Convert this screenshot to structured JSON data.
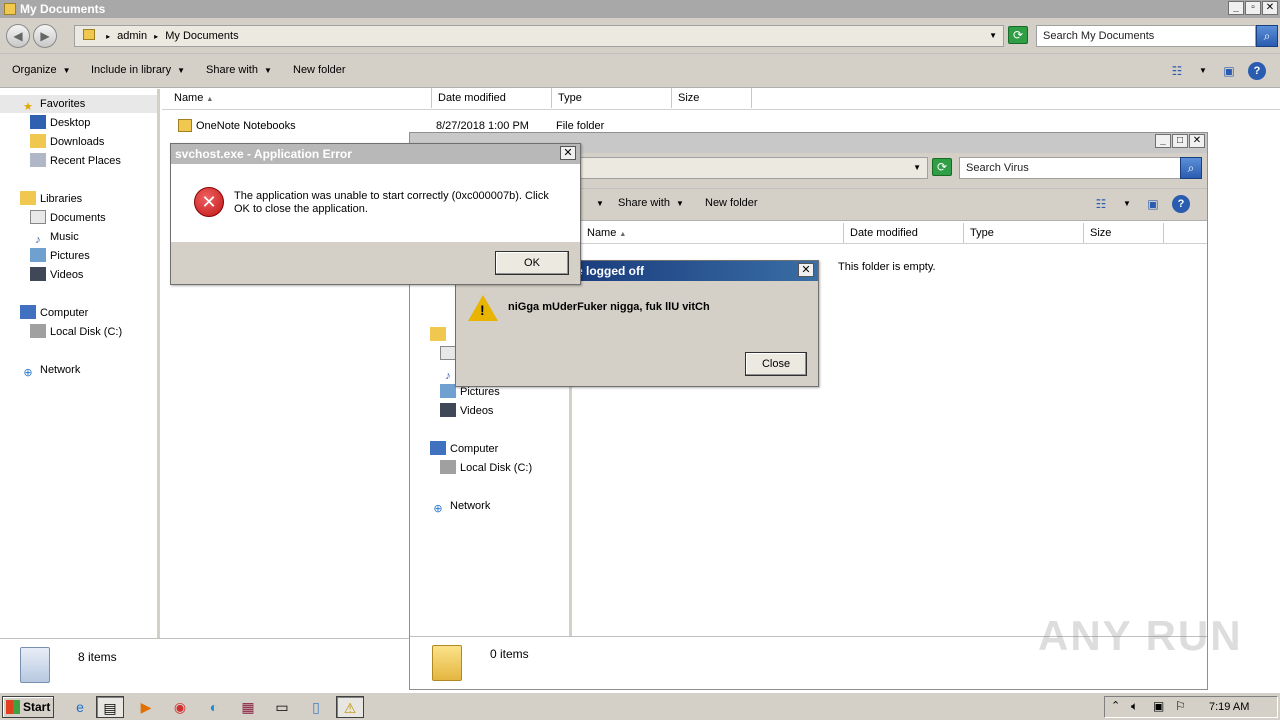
{
  "main_window": {
    "title": "My Documents",
    "breadcrumb": [
      "admin",
      "My Documents"
    ],
    "search_placeholder": "Search My Documents",
    "toolbar": {
      "organize": "Organize",
      "include_in_library": "Include in library",
      "share_with": "Share with",
      "new_folder": "New folder"
    },
    "columns": [
      "Name",
      "Date modified",
      "Type",
      "Size"
    ],
    "files": [
      {
        "name": "OneNote Notebooks",
        "date": "8/27/2018 1:00 PM",
        "type": "File folder",
        "size": ""
      }
    ],
    "status": "8 items"
  },
  "nav": {
    "favorites": "Favorites",
    "desktop": "Desktop",
    "downloads": "Downloads",
    "recent_places": "Recent Places",
    "libraries": "Libraries",
    "documents": "Documents",
    "music": "Music",
    "pictures": "Pictures",
    "videos": "Videos",
    "computer": "Computer",
    "local_disk": "Local Disk (C:)",
    "network": "Network"
  },
  "second_window": {
    "search_placeholder": "Search Virus",
    "toolbar": {
      "share_with": "Share with",
      "new_folder": "New folder"
    },
    "columns": [
      "Name",
      "Date modified",
      "Type",
      "Size"
    ],
    "empty_text": "This folder is empty.",
    "status": "0 items"
  },
  "error_dialog": {
    "title": "svchost.exe - Application Error",
    "message": "The application was unable to start correctly (0xc000007b). Click OK to close the application.",
    "ok": "OK"
  },
  "logoff_dialog": {
    "title": "e logged off",
    "message": "niGga mUderFuker nigga, fuk llU vitCh",
    "close": "Close"
  },
  "taskbar": {
    "start": "Start",
    "clock": "7:19 AM"
  },
  "watermark": "ANY RUN"
}
